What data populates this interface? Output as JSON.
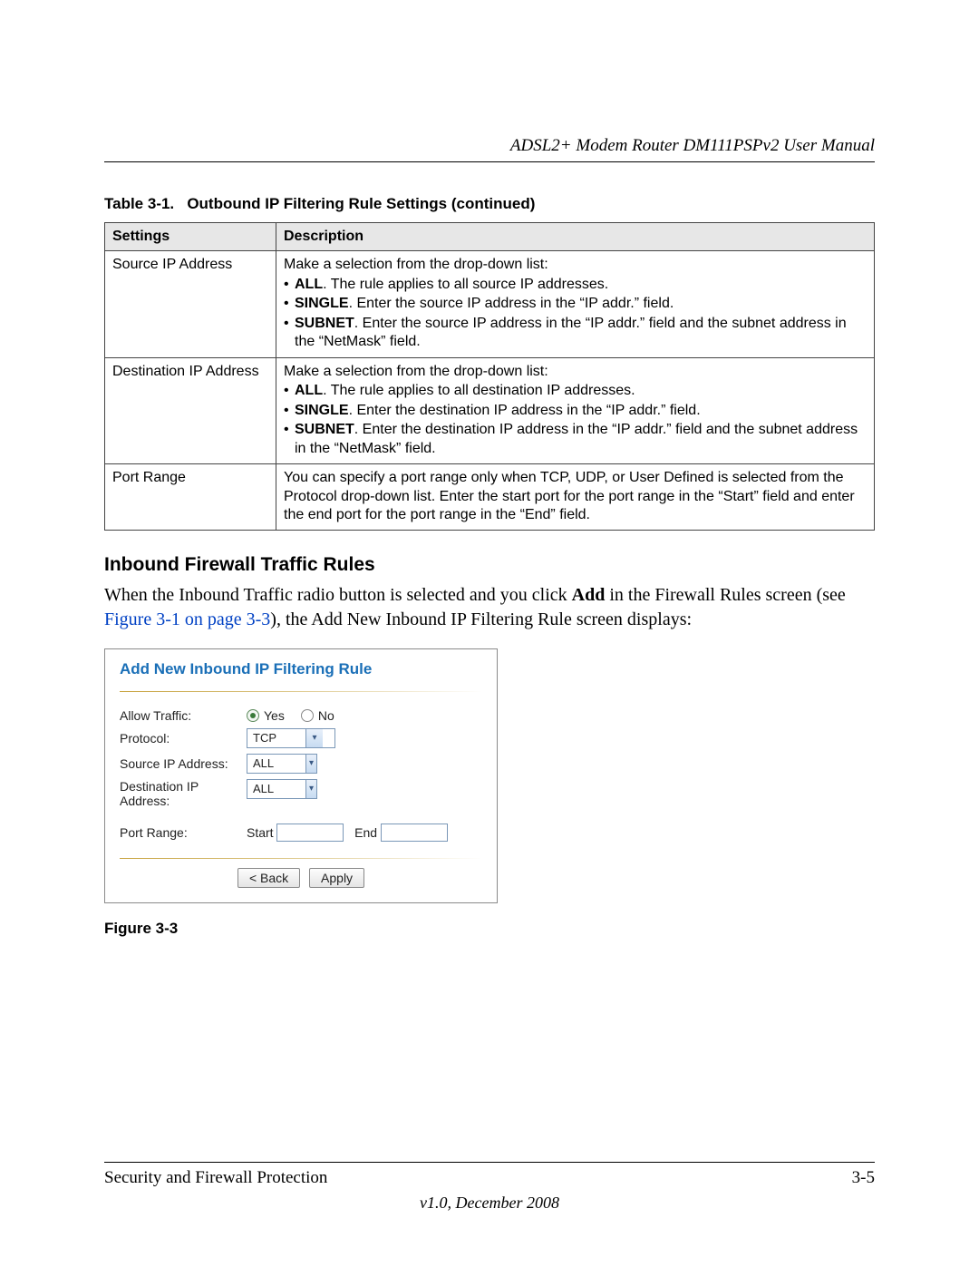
{
  "header": {
    "title": "ADSL2+ Modem Router DM111PSPv2 User Manual"
  },
  "table": {
    "caption_prefix": "Table 3-1.",
    "caption_rest": "Outbound IP Filtering Rule Settings (continued)",
    "head": {
      "c0": "Settings",
      "c1": "Description"
    },
    "rows": [
      {
        "setting": "Source IP Address",
        "intro": "Make a selection from the drop-down list:",
        "bullets": [
          {
            "b": "ALL",
            "rest": ". The rule applies to all source IP addresses."
          },
          {
            "b": "SINGLE",
            "rest": ". Enter the source IP address in the “IP addr.” field."
          },
          {
            "b": "SUBNET",
            "rest": ". Enter the source IP address in the “IP addr.” field and the subnet address in the “NetMask” field."
          }
        ]
      },
      {
        "setting": "Destination IP Address",
        "intro": "Make a selection from the drop-down list:",
        "bullets": [
          {
            "b": "ALL",
            "rest": ". The rule applies to all destination IP addresses."
          },
          {
            "b": "SINGLE",
            "rest": ". Enter the destination IP address in the “IP addr.” field."
          },
          {
            "b": "SUBNET",
            "rest": ". Enter the destination IP address in the “IP addr.” field and the subnet address in the “NetMask” field."
          }
        ]
      },
      {
        "setting": "Port Range",
        "intro": "You can specify a port range only when TCP, UDP, or User Defined is selected from the Protocol drop-down list. Enter the start port for the port range in the “Start” field and enter the end port for the port range in the “End” field.",
        "bullets": []
      }
    ]
  },
  "section": {
    "heading": "Inbound Firewall Traffic Rules"
  },
  "para": {
    "pre": "When the Inbound Traffic radio button is selected and you click ",
    "bold": "Add",
    "mid": " in the Firewall Rules screen (see ",
    "link": "Figure 3-1 on page 3-3",
    "post": "), the Add New Inbound IP Filtering Rule screen displays:"
  },
  "dialog": {
    "title": "Add New Inbound IP Filtering Rule",
    "allow_label": "Allow Traffic:",
    "yes": "Yes",
    "no": "No",
    "protocol_label": "Protocol:",
    "protocol_value": "TCP",
    "src_label": "Source IP Address:",
    "src_value": "ALL",
    "dst_label": "Destination IP Address:",
    "dst_value": "ALL",
    "port_label": "Port Range:",
    "start_label": "Start",
    "end_label": "End",
    "back": "< Back",
    "apply": "Apply"
  },
  "figure_caption": "Figure 3-3",
  "footer": {
    "left": "Security and Firewall Protection",
    "right": "3-5",
    "version": "v1.0, December 2008"
  },
  "glyph": {
    "bullet": "•",
    "chevron": "▾"
  }
}
